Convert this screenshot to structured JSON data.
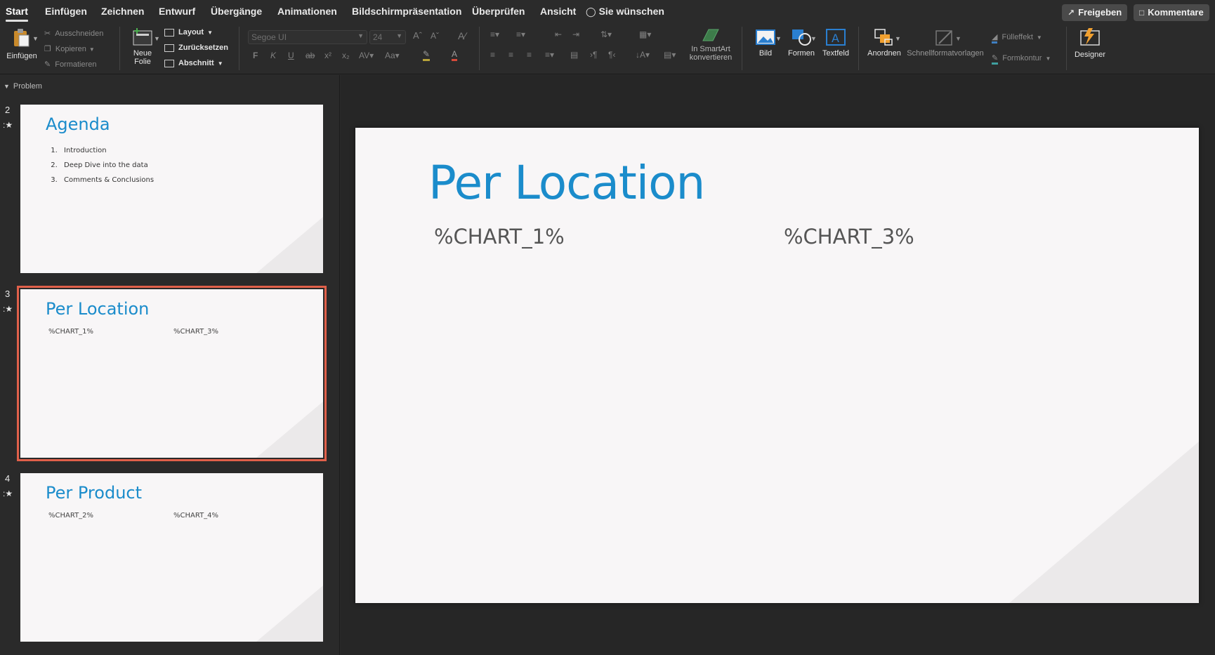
{
  "menu": {
    "tabs": [
      "Start",
      "Einfügen",
      "Zeichnen",
      "Entwurf",
      "Übergänge",
      "Animationen",
      "Bildschirmpräsentation",
      "Überprüfen",
      "Ansicht"
    ],
    "tell_me": "Sie wünschen",
    "share": "Freigeben",
    "comments": "Kommentare"
  },
  "ribbon": {
    "paste": "Einfügen",
    "cut": "Ausschneiden",
    "copy": "Kopieren",
    "format_painter": "Formatieren",
    "new_slide_1": "Neue",
    "new_slide_2": "Folie",
    "layout": "Layout",
    "reset": "Zurücksetzen",
    "section": "Abschnitt",
    "font_name": "Segoe UI",
    "font_size": "24",
    "smartart_1": "In SmartArt",
    "smartart_2": "konvertieren",
    "picture": "Bild",
    "shapes": "Formen",
    "textbox": "Textfeld",
    "arrange": "Anordnen",
    "quick_styles": "Schnellformatvorlagen",
    "shape_fill": "Fülleffekt",
    "shape_outline": "Formkontur",
    "designer": "Designer"
  },
  "panel": {
    "section_name": "Problem",
    "slides": [
      {
        "number": "2",
        "title": "Agenda",
        "items": [
          "Introduction",
          "Deep Dive into the data",
          "Comments & Conclusions"
        ]
      },
      {
        "number": "3",
        "title": "Per Location",
        "ph1": "%CHART_1%",
        "ph2": "%CHART_3%"
      },
      {
        "number": "4",
        "title": "Per Product",
        "ph1": "%CHART_2%",
        "ph2": "%CHART_4%"
      }
    ]
  },
  "slide": {
    "title": "Per Location",
    "placeholder_left": "%CHART_1%",
    "placeholder_right": "%CHART_3%"
  },
  "colors": {
    "accent_title": "#1b8ccb",
    "selection_border": "#e0604a",
    "designer_icon": "#f0a030"
  }
}
